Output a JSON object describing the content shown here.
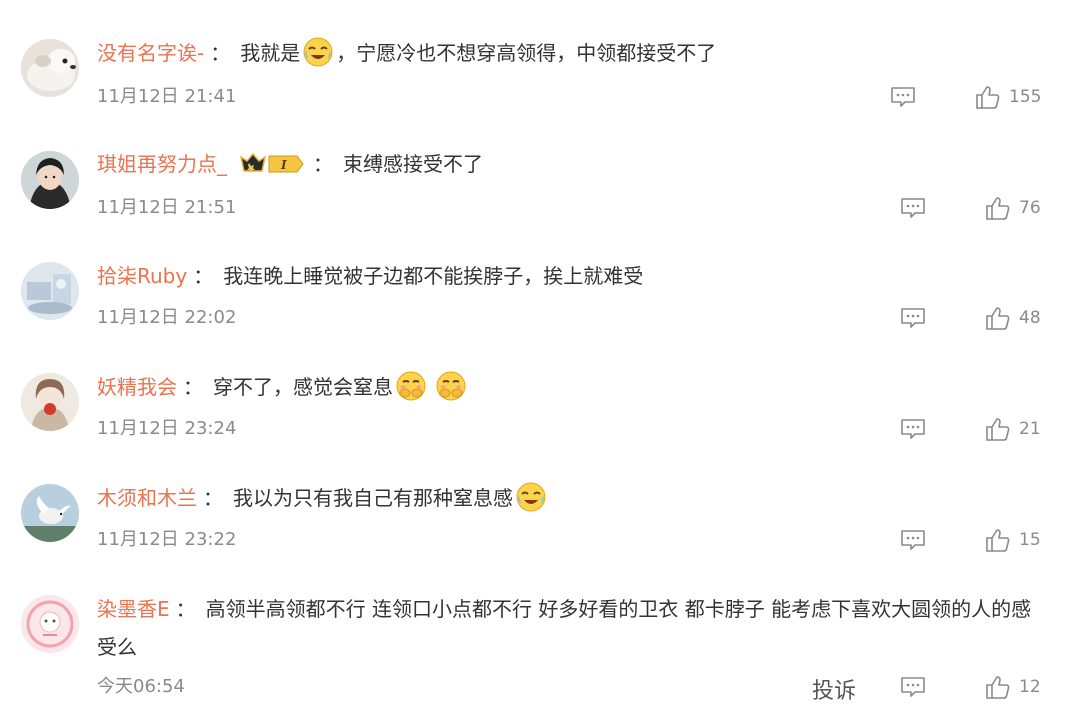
{
  "comments": [
    {
      "username": "没有名字诶-",
      "sep": "：",
      "text_before": "我就是",
      "text_after": "，宁愿冷也不想穿高领得，中领都接受不了",
      "time": "11月12日 21:41",
      "likes": "155",
      "emoji": "laugh-cry-emoji"
    },
    {
      "username": "琪姐再努力点_",
      "sep": "：",
      "text": "束缚感接受不了",
      "time": "11月12日 21:51",
      "likes": "76",
      "badge": "crown-badge",
      "badge_label": "I"
    },
    {
      "username": "拾柒Ruby",
      "sep": "：",
      "text": "我连晚上睡觉被子边都不能挨脖子，挨上就难受",
      "time": "11月12日 22:02",
      "likes": "48"
    },
    {
      "username": "妖精我会",
      "sep": "：",
      "text": "穿不了，感觉会窒息",
      "time": "11月12日 23:24",
      "likes": "21",
      "emoji": "covering-mouth-emoji"
    },
    {
      "username": "木须和木兰",
      "sep": "：",
      "text": "我以为只有我自己有那种窒息感",
      "time": "11月12日 23:22",
      "likes": "15",
      "emoji": "laugh-cry-emoji"
    },
    {
      "username": "染墨香E",
      "sep": "：",
      "text": "高领半高领都不行 连领口小点都不行 好多好看的卫衣 都卡脖子 能考虑下喜欢大圆领的人的感受么",
      "time": "今天06:54",
      "likes": "12",
      "report": "投诉"
    }
  ],
  "colors": {
    "username": "#eb7350",
    "text": "#333333",
    "meta": "#8a8a8a"
  }
}
